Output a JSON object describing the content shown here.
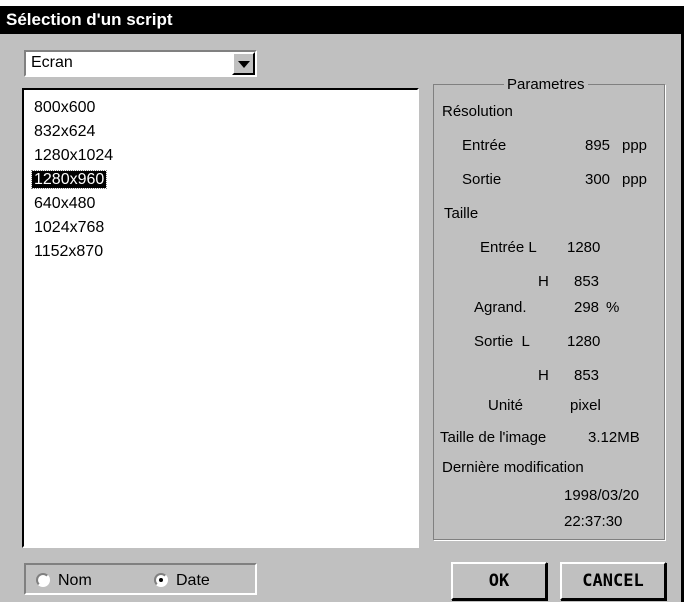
{
  "dialog": {
    "title": "Sélection d'un script"
  },
  "combo": {
    "value": "Ecran",
    "dropdown_icon": "chevron-down-icon"
  },
  "list": {
    "items": [
      "800x600",
      "832x624",
      "1280x1024",
      "1280x960",
      "640x480",
      "1024x768",
      "1152x870"
    ],
    "selected": "1280x960"
  },
  "sort": {
    "nom_label": "Nom",
    "date_label": "Date",
    "selected": "Date"
  },
  "params": {
    "legend": "Parametres",
    "resolution_label": "Résolution",
    "entree_label": "Entrée",
    "entree_value": "895",
    "entree_unit": "ppp",
    "sortie_label": "Sortie",
    "sortie_value": "300",
    "sortie_unit": "ppp",
    "taille_label": "Taille",
    "entree_l_label": "Entrée L",
    "entree_l_value": "1280",
    "entree_h_label": "H",
    "entree_h_value": "853",
    "agrand_label": "Agrand.",
    "agrand_value": "298",
    "agrand_unit": "%",
    "sortie_l_label": "Sortie  L",
    "sortie_l_value": "1280",
    "sortie_h_label": "H",
    "sortie_h_value": "853",
    "unite_label": "Unité",
    "unite_value": "pixel",
    "taille_image_label": "Taille de l'image",
    "taille_image_value": "3.12MB",
    "derniere_label": "Dernière modification",
    "date_value": "1998/03/20",
    "time_value": "22:37:30"
  },
  "buttons": {
    "ok": "OK",
    "cancel": "CANCEL"
  }
}
